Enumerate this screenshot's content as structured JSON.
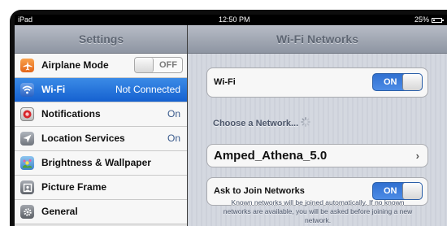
{
  "status_bar": {
    "carrier": "iPad",
    "time": "12:50 PM",
    "battery_text": "25%",
    "battery_level": 0.25
  },
  "settings_pane": {
    "title": "Settings",
    "items": [
      {
        "label": "Airplane Mode",
        "switch_text": "OFF",
        "icon": "airplane-icon",
        "icon_color": "#f4801f"
      },
      {
        "label": "Wi-Fi",
        "value": "Not Connected",
        "icon": "wifi-icon",
        "icon_color": "#3a74d0",
        "selected": true
      },
      {
        "label": "Notifications",
        "value": "On",
        "icon": "notifications-icon",
        "icon_color": "#d9272e"
      },
      {
        "label": "Location Services",
        "value": "On",
        "icon": "location-icon",
        "icon_color": "#8a8f98"
      },
      {
        "label": "Brightness & Wallpaper",
        "icon": "brightness-wallpaper-icon",
        "icon_color": "#5aa83a"
      },
      {
        "label": "Picture Frame",
        "icon": "picture-frame-icon",
        "icon_color": "#6c7078"
      },
      {
        "label": "General",
        "icon": "gear-icon",
        "icon_color": "#7d8087"
      }
    ]
  },
  "wifi_pane": {
    "title": "Wi-Fi Networks",
    "wifi_label": "Wi-Fi",
    "wifi_switch_text": "ON",
    "choose_label": "Choose a Network...",
    "network_name": "Amped_Athena_5.0",
    "ask_label": "Ask to Join Networks",
    "ask_switch_text": "ON",
    "footnote": "Known networks will be joined automatically. If no known networks are available, you will be asked before joining a new network."
  },
  "colors": {
    "accent": "#1f66d6",
    "header": "#9aa1ad"
  }
}
